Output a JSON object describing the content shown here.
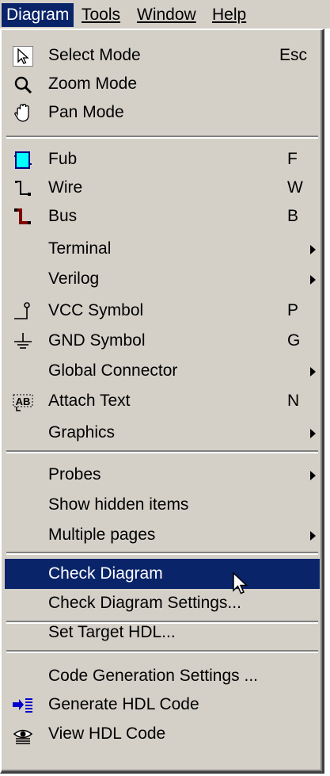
{
  "menubar": {
    "items": [
      {
        "label": "Diagram"
      },
      {
        "label": "Tools"
      },
      {
        "label": "Window"
      },
      {
        "label": "Help"
      }
    ]
  },
  "menu": {
    "items": [
      {
        "label": "Select Mode",
        "shortcut": "Esc",
        "icon": "arrow-pointer-icon"
      },
      {
        "label": "Zoom Mode",
        "icon": "magnifier-icon"
      },
      {
        "label": "Pan Mode",
        "icon": "hand-icon"
      },
      {
        "label": "Fub",
        "shortcut": "F",
        "icon": "fub-block-icon"
      },
      {
        "label": "Wire",
        "shortcut": "W",
        "icon": "wire-icon"
      },
      {
        "label": "Bus",
        "shortcut": "B",
        "icon": "bus-icon"
      },
      {
        "label": "Terminal",
        "submenu": true
      },
      {
        "label": "Verilog",
        "submenu": true
      },
      {
        "label": "VCC Symbol",
        "shortcut": "P",
        "icon": "vcc-icon"
      },
      {
        "label": "GND Symbol",
        "shortcut": "G",
        "icon": "gnd-icon"
      },
      {
        "label": "Global Connector",
        "submenu": true
      },
      {
        "label": "Attach Text",
        "shortcut": "N",
        "icon": "attach-text-icon"
      },
      {
        "label": "Graphics",
        "submenu": true
      },
      {
        "label": "Probes",
        "submenu": true
      },
      {
        "label": "Show hidden items"
      },
      {
        "label": "Multiple pages",
        "submenu": true
      },
      {
        "label": "Check Diagram",
        "highlighted": true
      },
      {
        "label": "Check Diagram Settings..."
      },
      {
        "label": "Set Target HDL..."
      },
      {
        "label": "Code Generation Settings ..."
      },
      {
        "label": "Generate HDL Code",
        "icon": "generate-hdl-icon"
      },
      {
        "label": "View HDL Code",
        "icon": "view-hdl-icon"
      }
    ]
  },
  "colors": {
    "menu_bg": "#d4d0c8",
    "highlight": "#0a246a",
    "fub_fill": "#00ffff",
    "icon_red": "#800000"
  }
}
